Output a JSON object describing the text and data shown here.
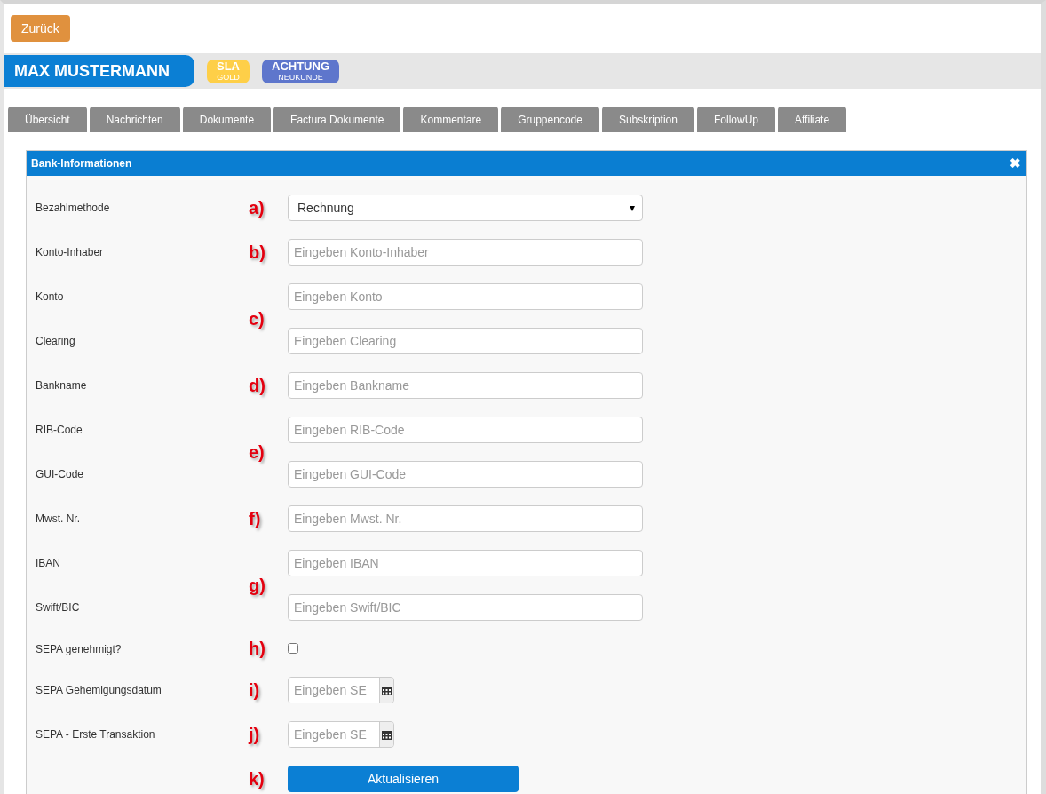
{
  "back_button": {
    "label": "Zurück"
  },
  "customer": {
    "name": "MAX MUSTERMANN",
    "badges": [
      {
        "title": "SLA",
        "subtitle": "GOLD",
        "color": "#fecf48"
      },
      {
        "title": "ACHTUNG",
        "subtitle": "NEUKUNDE",
        "color": "#5e76cc"
      }
    ]
  },
  "tabs": [
    {
      "label": "Übersicht",
      "selected": false
    },
    {
      "label": "Nachrichten",
      "selected": false
    },
    {
      "label": "Dokumente",
      "selected": false
    },
    {
      "label": "Factura Dokumente",
      "selected": false
    },
    {
      "label": "Kommentare",
      "selected": false
    },
    {
      "label": "Gruppencode",
      "selected": false
    },
    {
      "label": "Subskription",
      "selected": false
    },
    {
      "label": "FollowUp",
      "selected": false
    },
    {
      "label": "Affiliate",
      "selected": false
    }
  ],
  "panel": {
    "title": "Bank-Informationen",
    "close": "✖",
    "groups": [
      {
        "marker": "a)",
        "fields": [
          {
            "kind": "select",
            "label": "Bezahlmethode",
            "value": "Rechnung",
            "caret": "▾"
          }
        ]
      },
      {
        "marker": "b)",
        "fields": [
          {
            "kind": "text",
            "label": "Konto-Inhaber",
            "placeholder": "Eingeben Konto-Inhaber"
          }
        ]
      },
      {
        "marker": "c)",
        "fields": [
          {
            "kind": "text",
            "label": "Konto",
            "placeholder": "Eingeben Konto"
          },
          {
            "kind": "text",
            "label": "Clearing",
            "placeholder": "Eingeben Clearing"
          }
        ]
      },
      {
        "marker": "d)",
        "fields": [
          {
            "kind": "text",
            "label": "Bankname",
            "placeholder": "Eingeben Bankname"
          }
        ]
      },
      {
        "marker": "e)",
        "fields": [
          {
            "kind": "text",
            "label": "RIB-Code",
            "placeholder": "Eingeben RIB-Code"
          },
          {
            "kind": "text",
            "label": "GUI-Code",
            "placeholder": "Eingeben GUI-Code"
          }
        ]
      },
      {
        "marker": "f)",
        "fields": [
          {
            "kind": "text",
            "label": "Mwst. Nr.",
            "placeholder": "Eingeben Mwst. Nr."
          }
        ]
      },
      {
        "marker": "g)",
        "fields": [
          {
            "kind": "text",
            "label": "IBAN",
            "placeholder": "Eingeben IBAN"
          },
          {
            "kind": "text",
            "label": "Swift/BIC",
            "placeholder": "Eingeben Swift/BIC"
          }
        ]
      },
      {
        "marker": "h)",
        "fields": [
          {
            "kind": "checkbox",
            "label": "SEPA genehmigt?",
            "checked": false
          }
        ]
      },
      {
        "marker": "i)",
        "fields": [
          {
            "kind": "date",
            "label": "SEPA Gehemigungsdatum",
            "placeholder": "Eingeben SE"
          }
        ]
      },
      {
        "marker": "j)",
        "fields": [
          {
            "kind": "date",
            "label": "SEPA - Erste Transaktion",
            "placeholder": "Eingeben SE"
          }
        ]
      },
      {
        "marker": "k)",
        "fields": [
          {
            "kind": "button",
            "label": "Aktualisieren"
          }
        ]
      }
    ]
  }
}
